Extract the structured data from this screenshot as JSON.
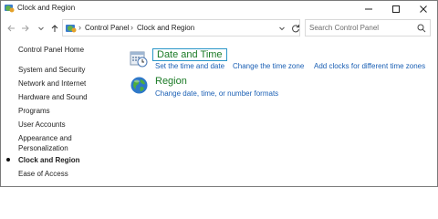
{
  "window": {
    "title": "Clock and Region",
    "accent_focus": "#2a96c8",
    "link_color": "#1a5fb4",
    "title_color": "#1a7a25"
  },
  "icons": {
    "app": "control-panel-icon",
    "minimize": "minimize-icon",
    "maximize": "maximize-icon",
    "close": "close-icon",
    "back": "arrow-left-icon",
    "forward": "arrow-right-icon",
    "recent": "chevron-down-icon",
    "up": "arrow-up-icon",
    "refresh": "refresh-icon",
    "search": "search-icon",
    "date_time": "calendar-clock-icon",
    "region": "globe-icon"
  },
  "address": {
    "segments": [
      "Control Panel",
      "Clock and Region"
    ]
  },
  "search": {
    "placeholder": "Search Control Panel"
  },
  "sidebar": {
    "home": "Control Panel Home",
    "items": [
      {
        "label": "System and Security"
      },
      {
        "label": "Network and Internet"
      },
      {
        "label": "Hardware and Sound"
      },
      {
        "label": "Programs"
      },
      {
        "label": "User Accounts"
      },
      {
        "label": "Appearance and Personalization"
      },
      {
        "label": "Clock and Region",
        "active": true
      },
      {
        "label": "Ease of Access"
      }
    ]
  },
  "categories": [
    {
      "title": "Date and Time",
      "links": [
        "Set the time and date",
        "Change the time zone",
        "Add clocks for different time zones"
      ]
    },
    {
      "title": "Region",
      "links": [
        "Change date, time, or number formats"
      ]
    }
  ]
}
